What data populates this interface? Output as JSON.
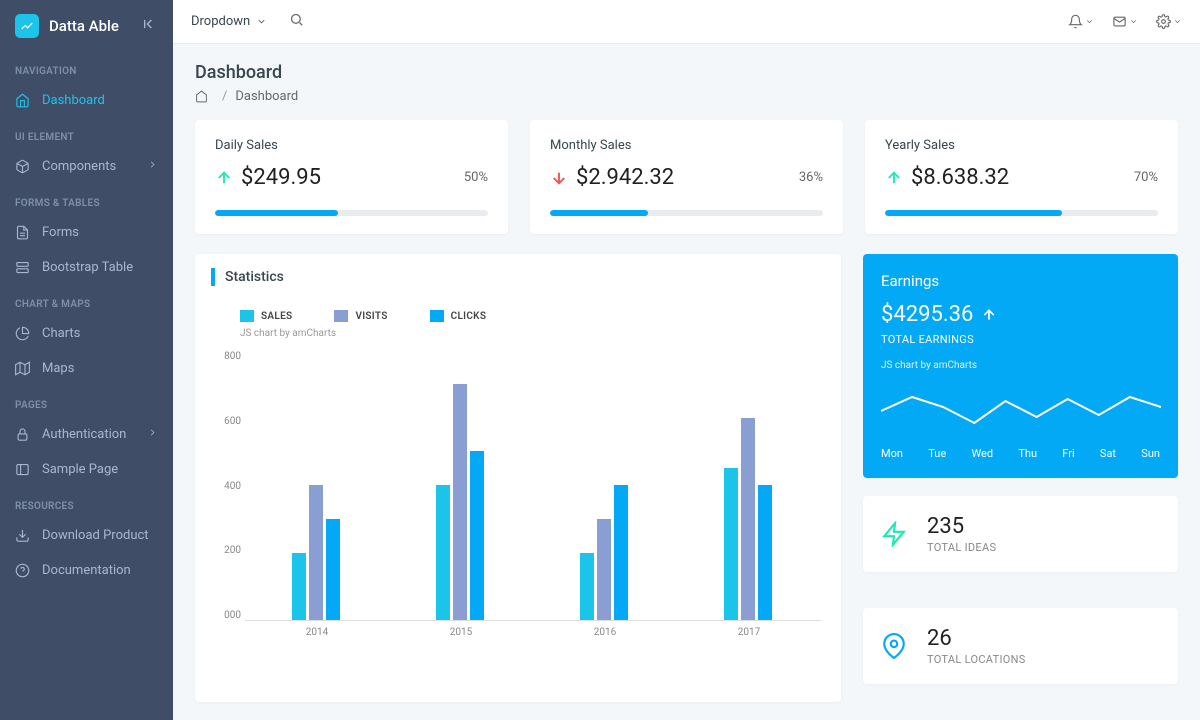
{
  "brand": "Datta Able",
  "sidebar": {
    "sections": [
      {
        "title": "NAVIGATION",
        "items": [
          {
            "label": "Dashboard",
            "icon": "home",
            "active": true
          }
        ]
      },
      {
        "title": "UI ELEMENT",
        "items": [
          {
            "label": "Components",
            "icon": "box",
            "chev": true
          }
        ]
      },
      {
        "title": "FORMS & TABLES",
        "items": [
          {
            "label": "Forms",
            "icon": "file"
          },
          {
            "label": "Bootstrap Table",
            "icon": "server"
          }
        ]
      },
      {
        "title": "CHART & MAPS",
        "items": [
          {
            "label": "Charts",
            "icon": "pie"
          },
          {
            "label": "Maps",
            "icon": "map"
          }
        ]
      },
      {
        "title": "PAGES",
        "items": [
          {
            "label": "Authentication",
            "icon": "lock",
            "chev": true
          },
          {
            "label": "Sample Page",
            "icon": "sidebar"
          }
        ]
      },
      {
        "title": "RESOURCES",
        "items": [
          {
            "label": "Download Product",
            "icon": "download"
          },
          {
            "label": "Documentation",
            "icon": "help"
          }
        ]
      }
    ]
  },
  "topbar": {
    "dropdown": "Dropdown"
  },
  "page": {
    "title": "Dashboard",
    "crumb": "Dashboard"
  },
  "sales": [
    {
      "label": "Daily Sales",
      "value": "$249.95",
      "pct": "50%",
      "dir": "up",
      "progress": 45
    },
    {
      "label": "Monthly Sales",
      "value": "$2.942.32",
      "pct": "36%",
      "dir": "down",
      "progress": 36
    },
    {
      "label": "Yearly Sales",
      "value": "$8.638.32",
      "pct": "70%",
      "dir": "up",
      "progress": 65
    }
  ],
  "stats_title": "Statistics",
  "chart_data": {
    "type": "bar",
    "title": "Statistics",
    "categories": [
      "2014",
      "2015",
      "2016",
      "2017"
    ],
    "series": [
      {
        "name": "SALES",
        "color": "#1dc4e9",
        "values": [
          200,
          400,
          200,
          450
        ]
      },
      {
        "name": "VISITS",
        "color": "#899fd4",
        "values": [
          400,
          700,
          300,
          600
        ]
      },
      {
        "name": "CLICKS",
        "color": "#04a9f5",
        "values": [
          300,
          500,
          400,
          400
        ]
      }
    ],
    "ylim": [
      0,
      800
    ],
    "y_ticks": [
      800,
      600,
      400,
      200,
      "000"
    ],
    "attribution": "JS chart by amCharts"
  },
  "earnings": {
    "title": "Earnings",
    "value": "$4295.36",
    "sub": "TOTAL EARNINGS",
    "attribution": "JS chart by amCharts",
    "days": [
      "Mon",
      "Tue",
      "Wed",
      "Thu",
      "Fri",
      "Sat",
      "Sun"
    ],
    "spark": [
      20,
      34,
      24,
      8,
      30,
      14,
      32,
      16,
      34,
      24
    ]
  },
  "stats_small": [
    {
      "value": "235",
      "label": "TOTAL IDEAS",
      "icon": "zap",
      "color": "#1de9b6"
    },
    {
      "value": "26",
      "label": "TOTAL LOCATIONS",
      "icon": "pin",
      "color": "#04a9f5"
    }
  ]
}
